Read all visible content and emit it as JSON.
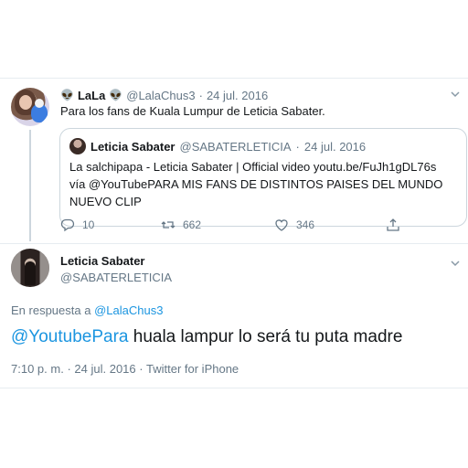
{
  "parent_tweet": {
    "emoji_left": "👽",
    "display_name": "LaLa",
    "emoji_right": "👽",
    "handle": "@LalaChus3",
    "separator": "·",
    "date": "24 jul. 2016",
    "text": "Para los fans de Kuala Lumpur de Leticia Sabater.",
    "quoted": {
      "display_name": "Leticia Sabater",
      "handle": "@SABATERLETICIA",
      "separator": "·",
      "date": "24 jul. 2016",
      "text": "La salchipapa - Leticia Sabater | Official video youtu.be/FuJh1gDL76s vía @YouTubePARA MIS FANS DE DISTINTOS PAISES DEL MUNDO NUEVO CLIP"
    },
    "actions": {
      "reply_count": "10",
      "retweet_count": "662",
      "like_count": "346"
    }
  },
  "main_tweet": {
    "display_name": "Leticia Sabater",
    "handle": "@SABATERLETICIA",
    "reply_prefix": "En respuesta a",
    "reply_to": "@LalaChus3",
    "mention": "@YoutubePara",
    "text": "huala lampur lo será tu puta madre",
    "time": "7:10 p. m.",
    "separator_1": "·",
    "date": "24 jul. 2016",
    "separator_2": "·",
    "source": "Twitter for iPhone"
  },
  "colors": {
    "link": "#1b95e0",
    "muted": "#657786",
    "divider": "#e6ecf0"
  }
}
